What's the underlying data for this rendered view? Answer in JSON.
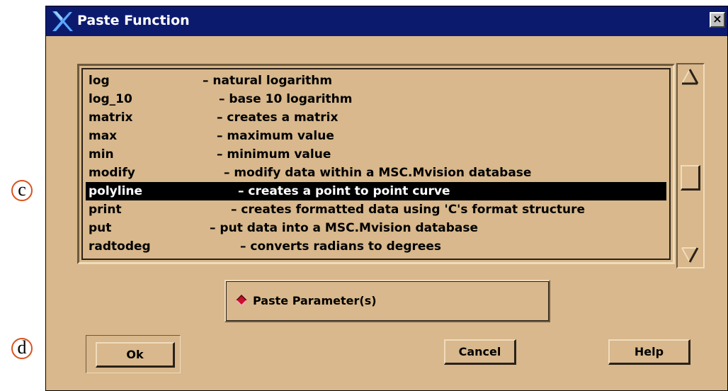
{
  "annotations": {
    "c": "c",
    "d": "d"
  },
  "window": {
    "title": "Paste Function",
    "logo_icon": "x-logo-icon",
    "close_label": "×"
  },
  "function_list": {
    "items": [
      {
        "name": "log",
        "desc": "– natural logarithm"
      },
      {
        "name": "log_10",
        "desc": "– base 10 logarithm"
      },
      {
        "name": "matrix",
        "desc": "– creates a matrix"
      },
      {
        "name": "max",
        "desc": "– maximum value"
      },
      {
        "name": "min",
        "desc": "– minimum value"
      },
      {
        "name": "modify",
        "desc": "– modify data within a MSC.Mvision database"
      },
      {
        "name": "polyline",
        "desc": "– creates a point to point curve"
      },
      {
        "name": "print",
        "desc": "– creates formatted data using 'C's format structure"
      },
      {
        "name": "put",
        "desc": "– put data into a MSC.Mvision database"
      },
      {
        "name": "radtodeg",
        "desc": "– converts radians to degrees"
      }
    ],
    "selected_index": 6
  },
  "options": {
    "paste_parameters_label": "Paste Parameter(s)",
    "paste_parameters_checked": true
  },
  "buttons": {
    "ok": "Ok",
    "cancel": "Cancel",
    "help": "Help"
  },
  "colors": {
    "dialog_bg": "#d8b88c",
    "titlebar_bg": "#0c1a6e",
    "selection_bg": "#000000",
    "toggle_diamond": "#c8102e",
    "annotation_circle": "#d9531e"
  }
}
